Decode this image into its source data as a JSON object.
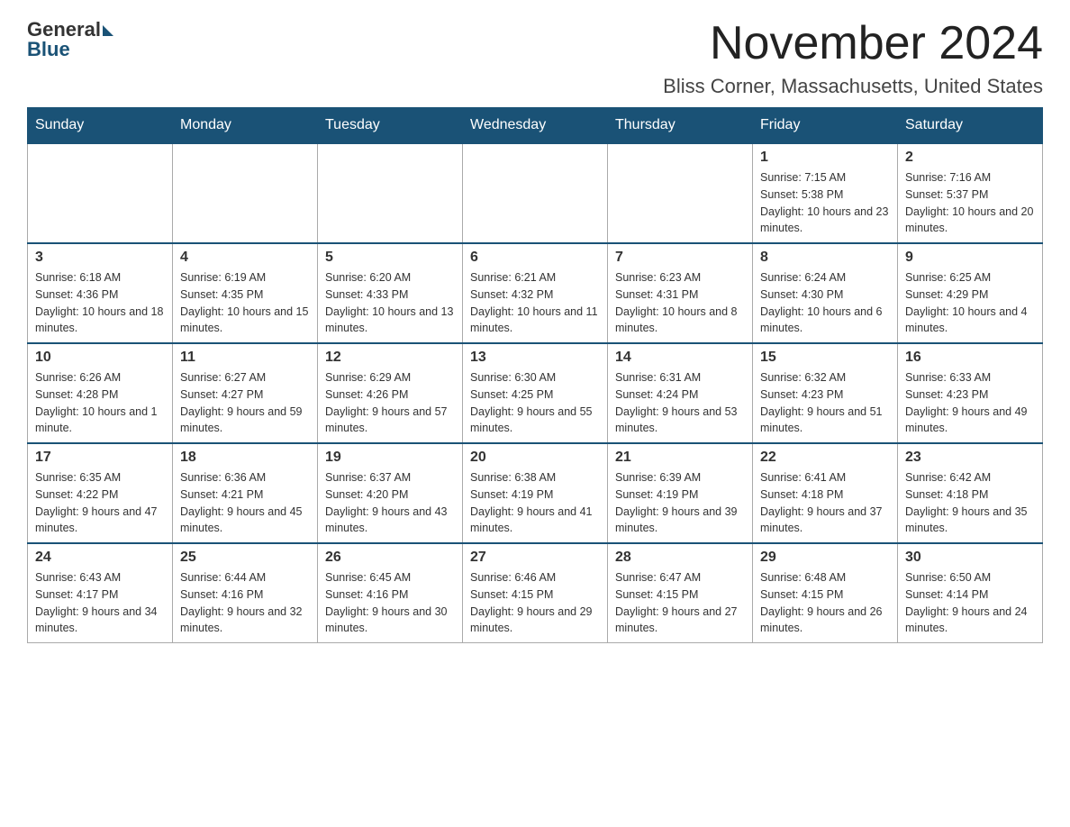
{
  "logo": {
    "general": "General",
    "blue": "Blue"
  },
  "title": "November 2024",
  "subtitle": "Bliss Corner, Massachusetts, United States",
  "days_of_week": [
    "Sunday",
    "Monday",
    "Tuesday",
    "Wednesday",
    "Thursday",
    "Friday",
    "Saturday"
  ],
  "weeks": [
    [
      {
        "day": "",
        "info": ""
      },
      {
        "day": "",
        "info": ""
      },
      {
        "day": "",
        "info": ""
      },
      {
        "day": "",
        "info": ""
      },
      {
        "day": "",
        "info": ""
      },
      {
        "day": "1",
        "info": "Sunrise: 7:15 AM\nSunset: 5:38 PM\nDaylight: 10 hours and 23 minutes."
      },
      {
        "day": "2",
        "info": "Sunrise: 7:16 AM\nSunset: 5:37 PM\nDaylight: 10 hours and 20 minutes."
      }
    ],
    [
      {
        "day": "3",
        "info": "Sunrise: 6:18 AM\nSunset: 4:36 PM\nDaylight: 10 hours and 18 minutes."
      },
      {
        "day": "4",
        "info": "Sunrise: 6:19 AM\nSunset: 4:35 PM\nDaylight: 10 hours and 15 minutes."
      },
      {
        "day": "5",
        "info": "Sunrise: 6:20 AM\nSunset: 4:33 PM\nDaylight: 10 hours and 13 minutes."
      },
      {
        "day": "6",
        "info": "Sunrise: 6:21 AM\nSunset: 4:32 PM\nDaylight: 10 hours and 11 minutes."
      },
      {
        "day": "7",
        "info": "Sunrise: 6:23 AM\nSunset: 4:31 PM\nDaylight: 10 hours and 8 minutes."
      },
      {
        "day": "8",
        "info": "Sunrise: 6:24 AM\nSunset: 4:30 PM\nDaylight: 10 hours and 6 minutes."
      },
      {
        "day": "9",
        "info": "Sunrise: 6:25 AM\nSunset: 4:29 PM\nDaylight: 10 hours and 4 minutes."
      }
    ],
    [
      {
        "day": "10",
        "info": "Sunrise: 6:26 AM\nSunset: 4:28 PM\nDaylight: 10 hours and 1 minute."
      },
      {
        "day": "11",
        "info": "Sunrise: 6:27 AM\nSunset: 4:27 PM\nDaylight: 9 hours and 59 minutes."
      },
      {
        "day": "12",
        "info": "Sunrise: 6:29 AM\nSunset: 4:26 PM\nDaylight: 9 hours and 57 minutes."
      },
      {
        "day": "13",
        "info": "Sunrise: 6:30 AM\nSunset: 4:25 PM\nDaylight: 9 hours and 55 minutes."
      },
      {
        "day": "14",
        "info": "Sunrise: 6:31 AM\nSunset: 4:24 PM\nDaylight: 9 hours and 53 minutes."
      },
      {
        "day": "15",
        "info": "Sunrise: 6:32 AM\nSunset: 4:23 PM\nDaylight: 9 hours and 51 minutes."
      },
      {
        "day": "16",
        "info": "Sunrise: 6:33 AM\nSunset: 4:23 PM\nDaylight: 9 hours and 49 minutes."
      }
    ],
    [
      {
        "day": "17",
        "info": "Sunrise: 6:35 AM\nSunset: 4:22 PM\nDaylight: 9 hours and 47 minutes."
      },
      {
        "day": "18",
        "info": "Sunrise: 6:36 AM\nSunset: 4:21 PM\nDaylight: 9 hours and 45 minutes."
      },
      {
        "day": "19",
        "info": "Sunrise: 6:37 AM\nSunset: 4:20 PM\nDaylight: 9 hours and 43 minutes."
      },
      {
        "day": "20",
        "info": "Sunrise: 6:38 AM\nSunset: 4:19 PM\nDaylight: 9 hours and 41 minutes."
      },
      {
        "day": "21",
        "info": "Sunrise: 6:39 AM\nSunset: 4:19 PM\nDaylight: 9 hours and 39 minutes."
      },
      {
        "day": "22",
        "info": "Sunrise: 6:41 AM\nSunset: 4:18 PM\nDaylight: 9 hours and 37 minutes."
      },
      {
        "day": "23",
        "info": "Sunrise: 6:42 AM\nSunset: 4:18 PM\nDaylight: 9 hours and 35 minutes."
      }
    ],
    [
      {
        "day": "24",
        "info": "Sunrise: 6:43 AM\nSunset: 4:17 PM\nDaylight: 9 hours and 34 minutes."
      },
      {
        "day": "25",
        "info": "Sunrise: 6:44 AM\nSunset: 4:16 PM\nDaylight: 9 hours and 32 minutes."
      },
      {
        "day": "26",
        "info": "Sunrise: 6:45 AM\nSunset: 4:16 PM\nDaylight: 9 hours and 30 minutes."
      },
      {
        "day": "27",
        "info": "Sunrise: 6:46 AM\nSunset: 4:15 PM\nDaylight: 9 hours and 29 minutes."
      },
      {
        "day": "28",
        "info": "Sunrise: 6:47 AM\nSunset: 4:15 PM\nDaylight: 9 hours and 27 minutes."
      },
      {
        "day": "29",
        "info": "Sunrise: 6:48 AM\nSunset: 4:15 PM\nDaylight: 9 hours and 26 minutes."
      },
      {
        "day": "30",
        "info": "Sunrise: 6:50 AM\nSunset: 4:14 PM\nDaylight: 9 hours and 24 minutes."
      }
    ]
  ]
}
